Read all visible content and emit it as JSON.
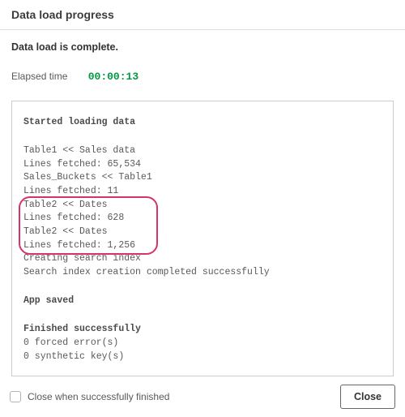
{
  "header": {
    "title": "Data load progress"
  },
  "status": {
    "message": "Data load is complete."
  },
  "elapsed": {
    "label": "Elapsed time",
    "value": "00:00:13"
  },
  "log": {
    "started_head": "Started loading data",
    "lines": [
      "Table1 << Sales data",
      "Lines fetched: 65,534",
      "Sales_Buckets << Table1",
      "Lines fetched: 11",
      "Table2 << Dates",
      "Lines fetched: 628",
      "Table2 << Dates",
      "Lines fetched: 1,256",
      "Creating search index",
      "Search index creation completed successfully"
    ],
    "app_saved_head": "App saved",
    "finished_head": "Finished successfully",
    "forced_errors": "0 forced error(s)",
    "synthetic_keys": "0 synthetic key(s)"
  },
  "footer": {
    "checkbox_label": "Close when successfully finished",
    "close_button": "Close"
  }
}
